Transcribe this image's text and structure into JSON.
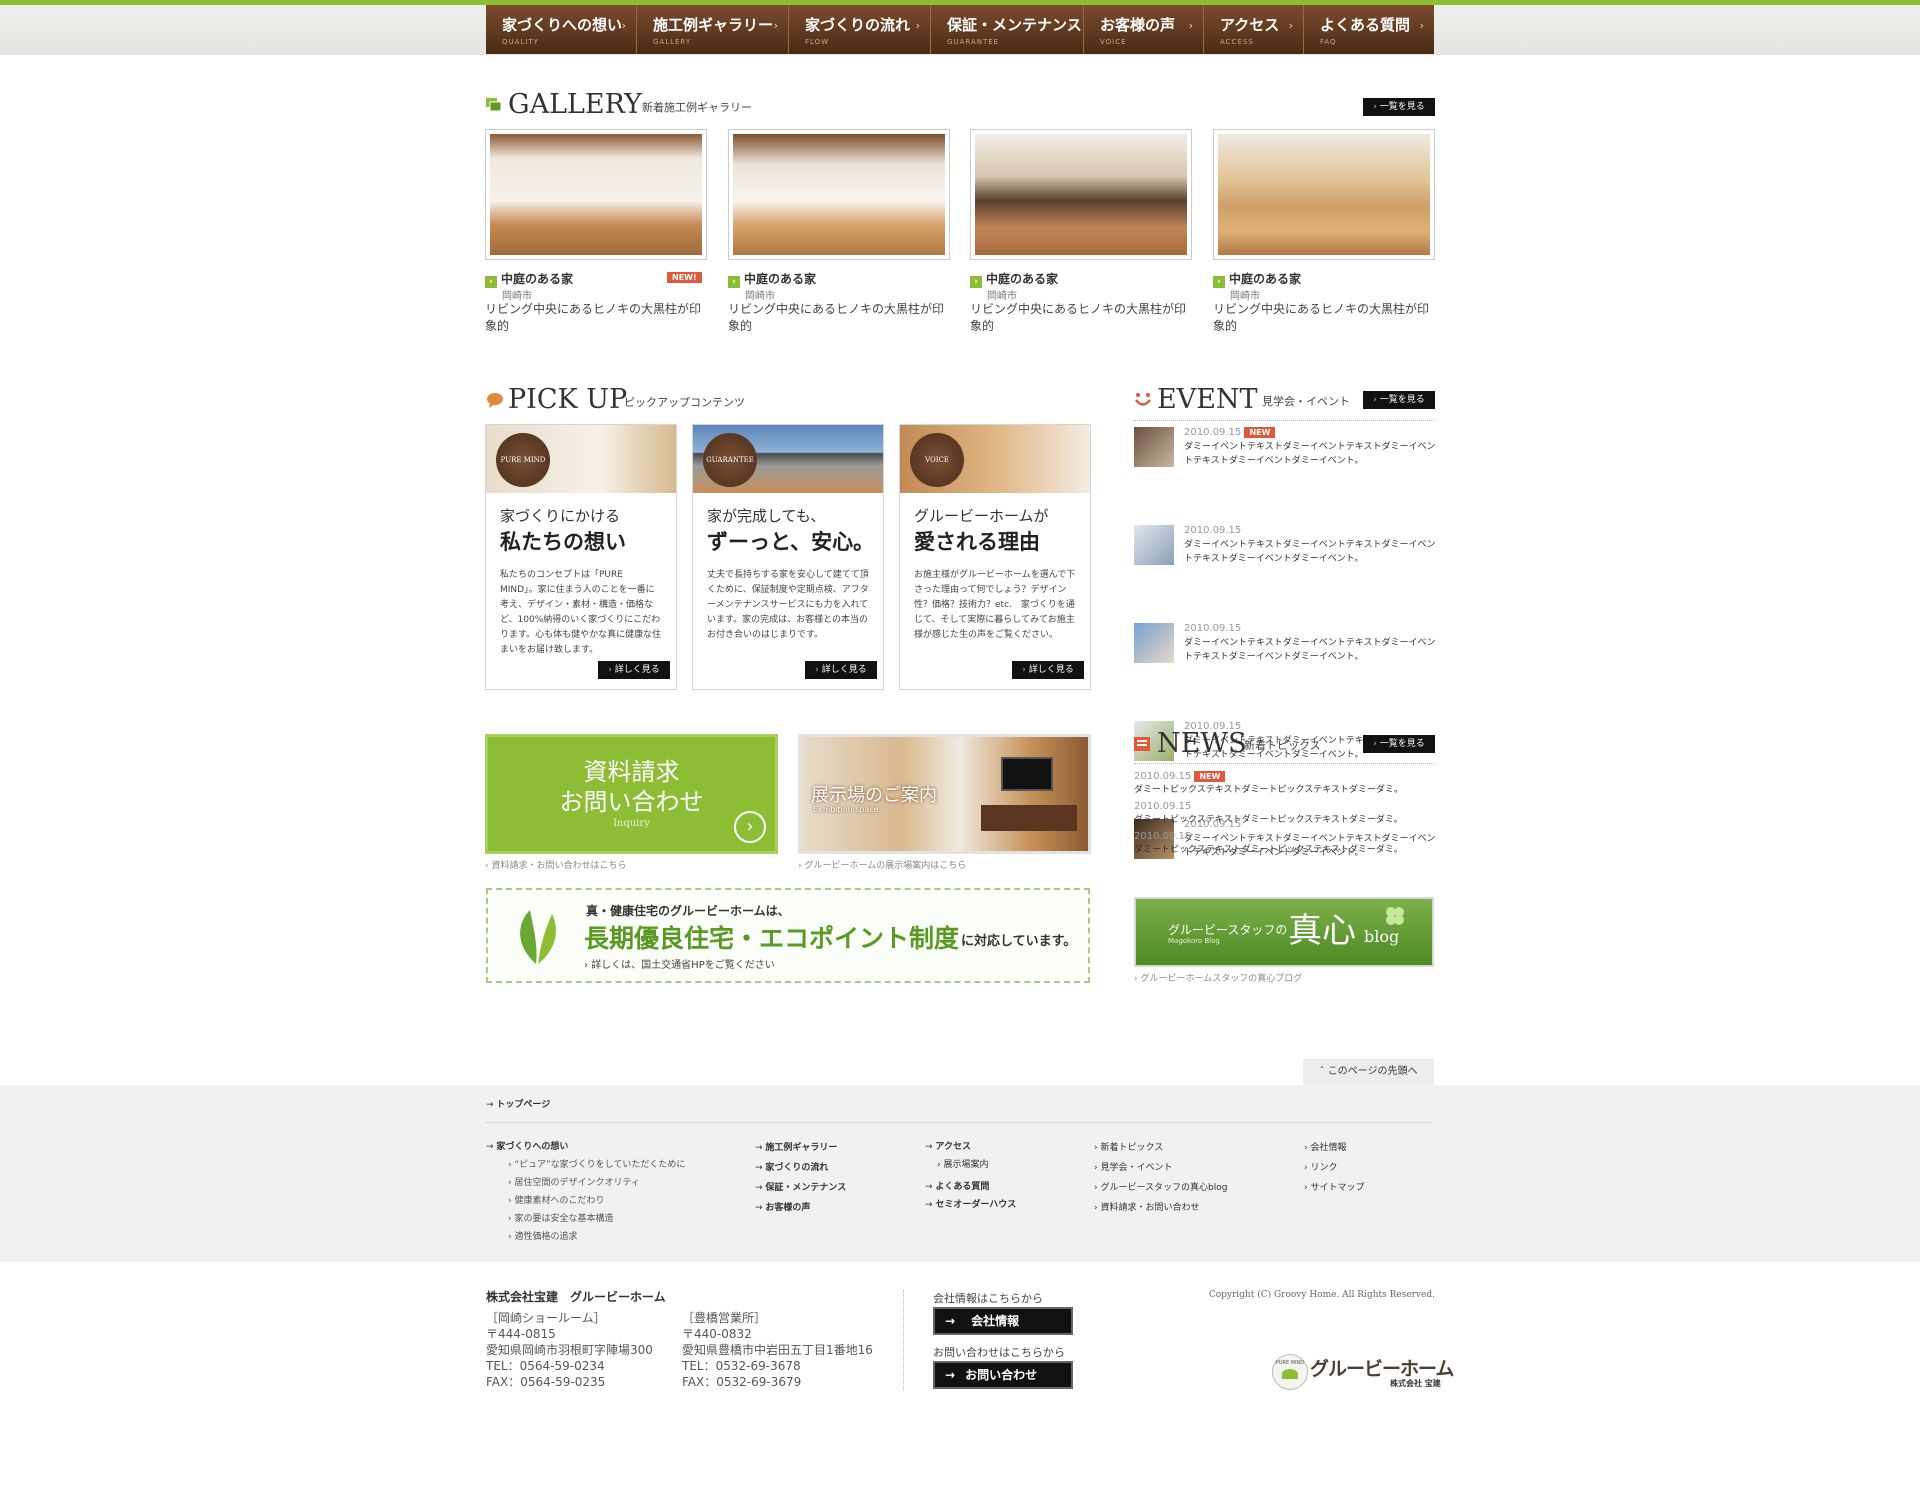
{
  "nav": [
    {
      "jp": "家づくりへの想い",
      "en": "QUALITY"
    },
    {
      "jp": "施工例ギャラリー",
      "en": "GALLERY"
    },
    {
      "jp": "家づくりの流れ",
      "en": "FLOW"
    },
    {
      "jp": "保証・メンテナンス",
      "en": "GUARANTEE"
    },
    {
      "jp": "お客様の声",
      "en": "VOICE"
    },
    {
      "jp": "アクセス",
      "en": "ACCESS"
    },
    {
      "jp": "よくある質問",
      "en": "FAQ"
    }
  ],
  "more_label": "一覧を見る",
  "gallery": {
    "title": "GALLERY",
    "subtitle": "新着施工例ギャラリー",
    "new_label": "NEW!",
    "items": [
      {
        "title": "中庭のある家",
        "city": "岡崎市",
        "desc": "リビング中央にあるヒノキの大黒柱が印象的"
      },
      {
        "title": "中庭のある家",
        "city": "岡崎市",
        "desc": "リビング中央にあるヒノキの大黒柱が印象的"
      },
      {
        "title": "中庭のある家",
        "city": "岡崎市",
        "desc": "リビング中央にあるヒノキの大黒柱が印象的"
      },
      {
        "title": "中庭のある家",
        "city": "岡崎市",
        "desc": "リビング中央にあるヒノキの大黒柱が印象的"
      }
    ]
  },
  "pickup": {
    "title": "PICK UP",
    "subtitle": "ピックアップコンテンツ",
    "detail_label": "詳しく見る",
    "cards": [
      {
        "badge": "PURE MIND",
        "h1": "家づくりにかける",
        "h2": "私たちの想い",
        "body": "私たちのコンセプトは「PURE MIND」。家に住まう人のことを一番に考え、デザイン・素材・構造・価格など、100%納得のいく家づくりにこだわります。心も体も健やかな真に健康な住まいをお届け致します。"
      },
      {
        "badge": "GUARANTEE",
        "h1": "家が完成しても、",
        "h2": "ずーっと、安心。",
        "body": "丈夫で長持ちする家を安心して建てて頂くために、保証制度や定期点検、アフターメンテナンスサービスにも力を入れています。家の完成は、お客様との本当のお付き合いのはじまりです。"
      },
      {
        "badge": "VOICE",
        "h1": "グルービーホームが",
        "h2": "愛される理由",
        "body": "お施主様がグルービーホームを選んで下さった理由って何でしょう？デザイン性？価格？技術力？etc.　家づくりを通じて、そして実際に暮らしてみてお施主様が感じた生の声をご覧ください。"
      }
    ]
  },
  "event": {
    "title": "EVENT",
    "subtitle": "見学会・イベント",
    "new_label": "NEW",
    "items": [
      {
        "date": "2010.09.15",
        "text": "ダミーイベントテキストダミーイベントテキストダミーイベントテキストダミーイベントダミーイベント。"
      },
      {
        "date": "2010.09.15",
        "text": "ダミーイベントテキストダミーイベントテキストダミーイベントテキストダミーイベントダミーイベント。"
      },
      {
        "date": "2010.09.15",
        "text": "ダミーイベントテキストダミーイベントテキストダミーイベントテキストダミーイベントダミーイベント。"
      },
      {
        "date": "2010.09.15",
        "text": "ダミーイベントテキストダミーイベントテキストダミーイベントテキストダミーイベントダミーイベント。"
      },
      {
        "date": "2010.09.15",
        "text": "ダミーイベントテキストダミーイベントテキストダミーイベントテキストダミーイベントダミーイベント。"
      }
    ]
  },
  "news": {
    "title": "NEWS",
    "subtitle": "新着トピックス",
    "new_label": "NEW",
    "items": [
      {
        "date": "2010.09.15",
        "text": "ダミートピックステキストダミートピックステキストダミーダミ。"
      },
      {
        "date": "2010.09.15",
        "text": "ダミートピックステキストダミートピックステキストダミーダミ。"
      },
      {
        "date": "2010.09.15",
        "text": "ダミートピックステキストダミートピックステキストダミーダミ。"
      }
    ]
  },
  "inquiry": {
    "line1": "資料請求",
    "line2": "お問い合わせ",
    "en": "Inquiry",
    "caption": "資料請求・お問い合わせはこちら"
  },
  "showroom": {
    "title": "展示場のご案内",
    "en": "Exhibition space",
    "caption": "グルービーホームの展示場案内はこちら"
  },
  "eco": {
    "lead": "真・健康住宅のグルービーホームは、",
    "main": "長期優良住宅・エコポイント制度",
    "tail": "に対応しています。",
    "link": "詳しくは、国土交通省HPをご覧ください"
  },
  "blog": {
    "pre": "グルービースタッフの",
    "big": "真心",
    "blog": "blog",
    "en": "Magokoro Blog",
    "caption": "グルービーホームスタッフの真心ブログ"
  },
  "pagetop": "このページの先頭へ",
  "footer_nav": {
    "top": "トップページ",
    "col1": {
      "head": "家づくりへの想い",
      "subs": [
        "“ピュア”な家づくりをしていただくために",
        "居住空間のデザインクオリティ",
        "健康素材へのこだわり",
        "家の要は安全な基本構造",
        "適性価格の追求"
      ]
    },
    "col2": [
      "施工例ギャラリー",
      "家づくりの流れ",
      "保証・メンテナンス",
      "お客様の声"
    ],
    "col3": {
      "a": "アクセス",
      "a_sub": "展示場案内",
      "b": "よくある質問",
      "c": "セミオーダーハウス"
    },
    "col4": [
      "新着トピックス",
      "見学会・イベント",
      "グルービースタッフの真心blog",
      "資料請求・お問い合わせ"
    ],
    "col5": [
      "会社情報",
      "リンク",
      "サイトマップ"
    ]
  },
  "company": {
    "name": "株式会社宝建　グルービーホーム",
    "showroom": {
      "label": "［岡崎ショールーム］",
      "zip": "〒444-0815",
      "addr": "愛知県岡崎市羽根町字陣場300",
      "tel": "TEL：0564-59-0234",
      "fax": "FAX：0564-59-0235"
    },
    "office": {
      "label": "［豊橋営業所］",
      "zip": "〒440-0832",
      "addr": "愛知県豊橋市中岩田五丁目1番地16",
      "tel": "TEL：0532-69-3678",
      "fax": "FAX：0532-69-3679"
    },
    "info_caption": "会社情報はこちらから",
    "info_btn": "会社情報",
    "contact_caption": "お問い合わせはこちらから",
    "contact_btn": "お問い合わせ",
    "copyright": "Copyright (C) Groovy Home. All Rights Reserved.",
    "logo": "グルービーホーム",
    "logo_sub": "株式会社 宝建",
    "logo_mark": "PURE MIND"
  }
}
